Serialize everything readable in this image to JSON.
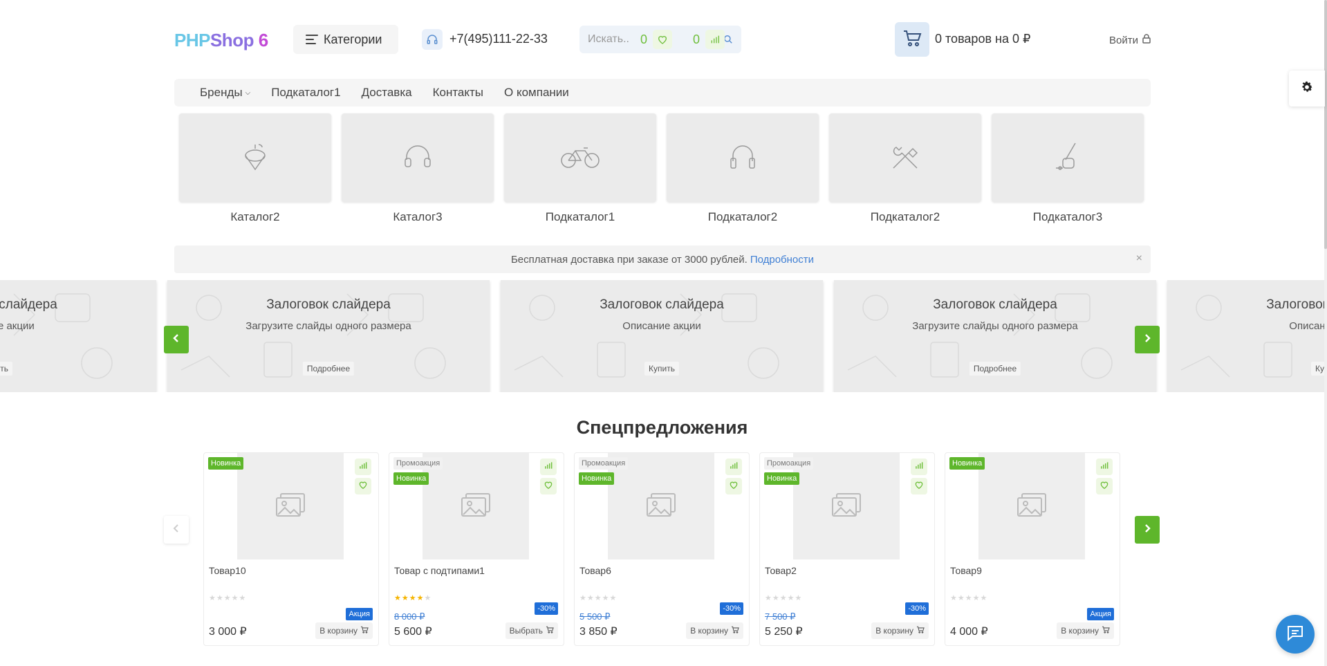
{
  "header": {
    "logo": {
      "part1": "PHP",
      "part2": "Shop",
      "part3": " 6"
    },
    "categories_label": "Категории",
    "phone": "+7(495)111-22-33",
    "search_placeholder": "Искать..",
    "wishlist_count": "0",
    "compare_count": "0",
    "cart_text": "0  товаров на  0  ₽",
    "login_label": "Войти"
  },
  "nav": {
    "items": [
      "Бренды",
      "Подкаталог1",
      "Доставка",
      "Контакты",
      "О компании"
    ]
  },
  "categories": [
    {
      "label": "Каталог2",
      "icon": "spinning-top-icon"
    },
    {
      "label": "Каталог3",
      "icon": "headphones-icon"
    },
    {
      "label": "Подкаталог1",
      "icon": "bicycle-icon"
    },
    {
      "label": "Подкаталог2",
      "icon": "headphones-icon"
    },
    {
      "label": "Подкаталог2",
      "icon": "tools-icon"
    },
    {
      "label": "Подкаталог3",
      "icon": "vacuum-icon"
    }
  ],
  "notice": {
    "text": "Бесплатная доставка при заказе от 3000 рублей.",
    "link": "Подробности",
    "close": "×"
  },
  "slider": {
    "slides": [
      {
        "title": "Залоговок слайдера",
        "desc": "Описание акции",
        "button": "Купить"
      },
      {
        "title": "Залоговок слайдера",
        "desc": "Загрузите слайды одного размера",
        "button": "Подробнее"
      },
      {
        "title": "Залоговок слайдера",
        "desc": "Описание акции",
        "button": "Купить"
      },
      {
        "title": "Залоговок слайдера",
        "desc": "Загрузите слайды одного размера",
        "button": "Подробнее"
      },
      {
        "title": "Залоговок слайдера",
        "desc": "Описание акции",
        "button": "Купить"
      }
    ]
  },
  "specials": {
    "title": "Спецпредложения",
    "products": [
      {
        "name": "Товар10",
        "badges": [
          "Новинка"
        ],
        "promo": false,
        "rating": 0,
        "old_price": "",
        "price": "3 000 ₽",
        "price_badge": "Акция",
        "button": "В корзину"
      },
      {
        "name": "Товар с подтипами1",
        "badges": [
          "Промоакция",
          "Новинка"
        ],
        "promo": true,
        "rating": 4,
        "old_price": "8 000  ₽",
        "price": "5 600 ₽",
        "price_badge": "-30%",
        "button": "Выбрать"
      },
      {
        "name": "Товар6",
        "badges": [
          "Промоакция",
          "Новинка"
        ],
        "promo": true,
        "rating": 0,
        "old_price": "5 500  ₽",
        "price": "3 850 ₽",
        "price_badge": "-30%",
        "button": "В корзину"
      },
      {
        "name": "Товар2",
        "badges": [
          "Промоакция",
          "Новинка"
        ],
        "promo": true,
        "rating": 0,
        "old_price": "7 500  ₽",
        "price": "5 250 ₽",
        "price_badge": "-30%",
        "button": "В корзину"
      },
      {
        "name": "Товар9",
        "badges": [
          "Новинка"
        ],
        "promo": false,
        "rating": 0,
        "old_price": "",
        "price": "4 000 ₽",
        "price_badge": "Акция",
        "button": "В корзину"
      }
    ]
  },
  "colors": {
    "accent_green": "#5eb62b",
    "link_blue": "#3f7fd4",
    "price_badge_blue": "#1f6ed8",
    "chat_blue": "#2e8ad8"
  }
}
